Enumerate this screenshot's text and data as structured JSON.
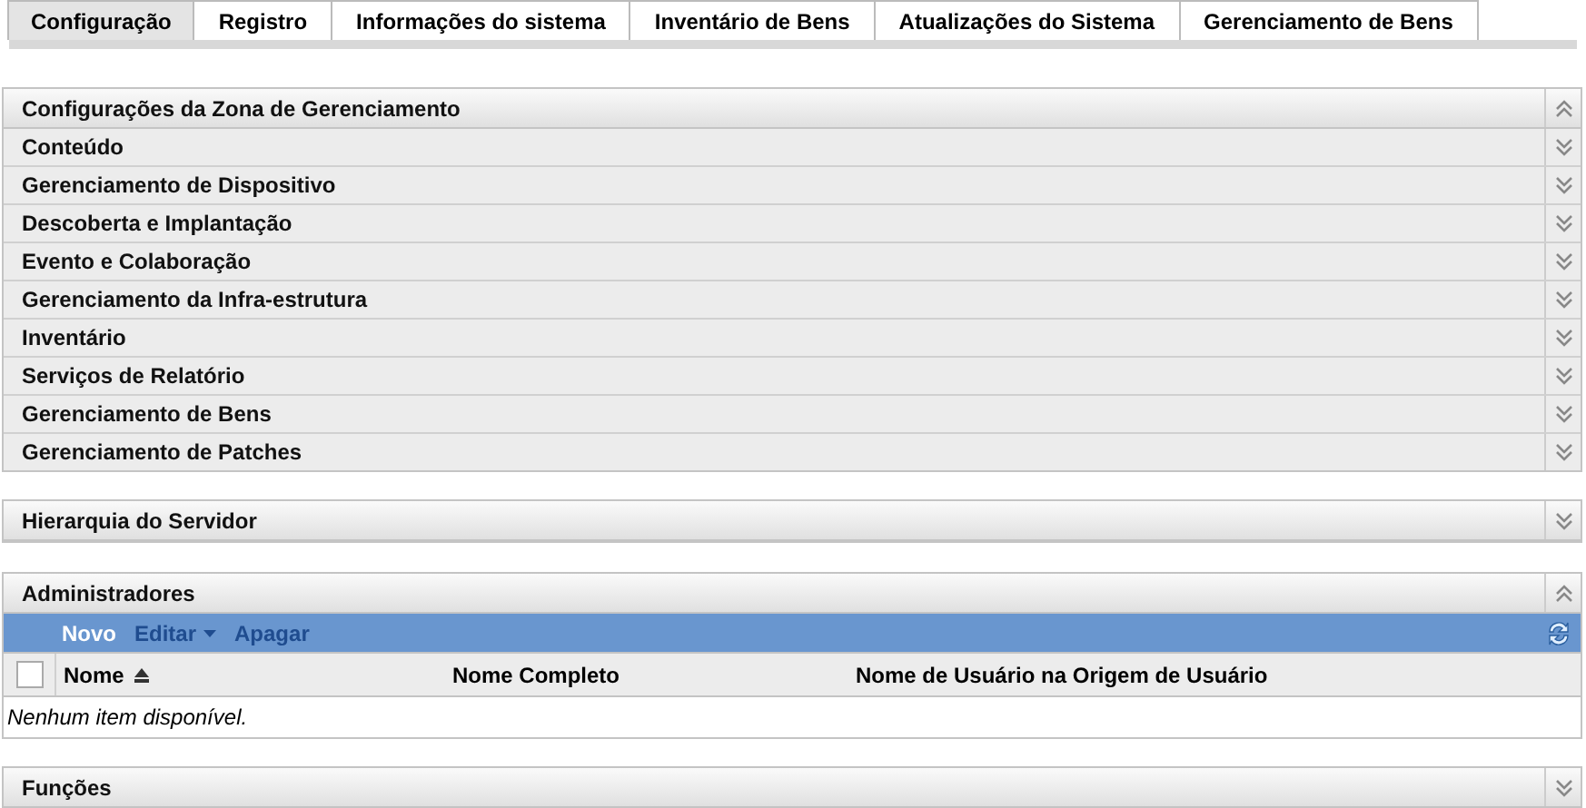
{
  "tabs": [
    {
      "label": "Configuração",
      "selected": true
    },
    {
      "label": "Registro",
      "selected": false
    },
    {
      "label": "Informações do sistema",
      "selected": false
    },
    {
      "label": "Inventário de Bens",
      "selected": false
    },
    {
      "label": "Atualizações do Sistema",
      "selected": false
    },
    {
      "label": "Gerenciamento de Bens",
      "selected": false
    }
  ],
  "settings_panel": {
    "title": "Configurações da Zona de Gerenciamento",
    "expanded": true,
    "items": [
      {
        "label": "Conteúdo",
        "expanded": false
      },
      {
        "label": "Gerenciamento de Dispositivo",
        "expanded": false
      },
      {
        "label": "Descoberta e Implantação",
        "expanded": false
      },
      {
        "label": "Evento e Colaboração",
        "expanded": false
      },
      {
        "label": "Gerenciamento da Infra-estrutura",
        "expanded": false
      },
      {
        "label": "Inventário",
        "expanded": false
      },
      {
        "label": "Serviços de Relatório",
        "expanded": false
      },
      {
        "label": "Gerenciamento de Bens",
        "expanded": false
      },
      {
        "label": "Gerenciamento de Patches",
        "expanded": false
      }
    ]
  },
  "server_panel": {
    "title": "Hierarquia do Servidor",
    "expanded": false
  },
  "admin_panel": {
    "title": "Administradores",
    "expanded": true,
    "toolbar": [
      {
        "label": "Novo",
        "disabled": false,
        "kind": "button"
      },
      {
        "label": "Editar",
        "disabled": true,
        "kind": "menu"
      },
      {
        "label": "Apagar",
        "disabled": true,
        "kind": "button"
      }
    ],
    "table": {
      "select_all_checked": false,
      "columns": [
        {
          "label": "Nome",
          "sorted": true
        },
        {
          "label": "Nome Completo",
          "sorted": false
        },
        {
          "label": "Nome de Usuário na Origem de Usuário",
          "sorted": false
        }
      ],
      "empty_message": "Nenhum item disponível."
    }
  },
  "roles_panel": {
    "title": "Funções",
    "expanded": false
  }
}
